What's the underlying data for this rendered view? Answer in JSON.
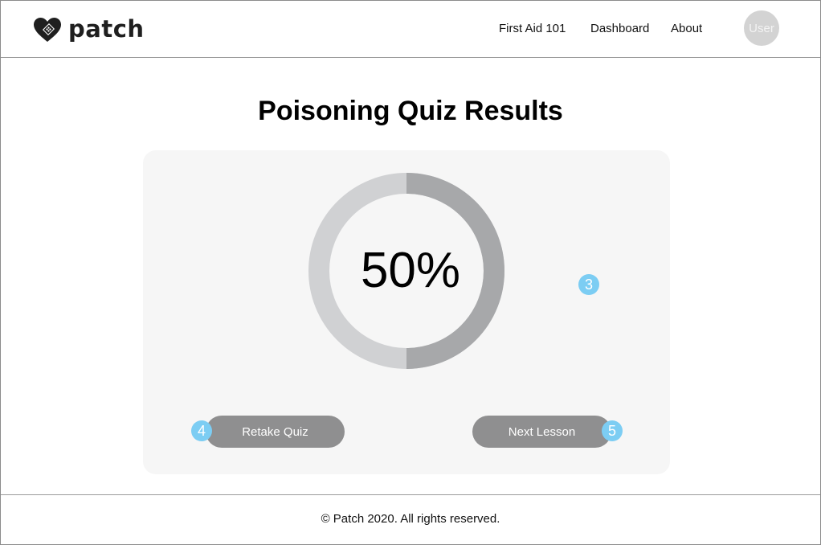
{
  "header": {
    "brand": "patch",
    "nav": [
      "First Aid 101",
      "Dashboard",
      "About"
    ],
    "user_label": "User"
  },
  "main": {
    "title": "Poisoning Quiz Results",
    "score_text": "50%",
    "score_fraction": 0.5,
    "retake_label": "Retake Quiz",
    "next_label": "Next Lesson"
  },
  "annotations": [
    "3",
    "4",
    "5"
  ],
  "footer": {
    "copyright": "© Patch 2020. All rights reserved."
  },
  "colors": {
    "ring_fill": "#a7a8aa",
    "ring_track": "#d0d1d3",
    "button": "#8f8f90",
    "card": "#f6f6f6",
    "marker": "#7ccdf3"
  },
  "icons": {
    "logo": "heart-bandage-logo-icon"
  }
}
